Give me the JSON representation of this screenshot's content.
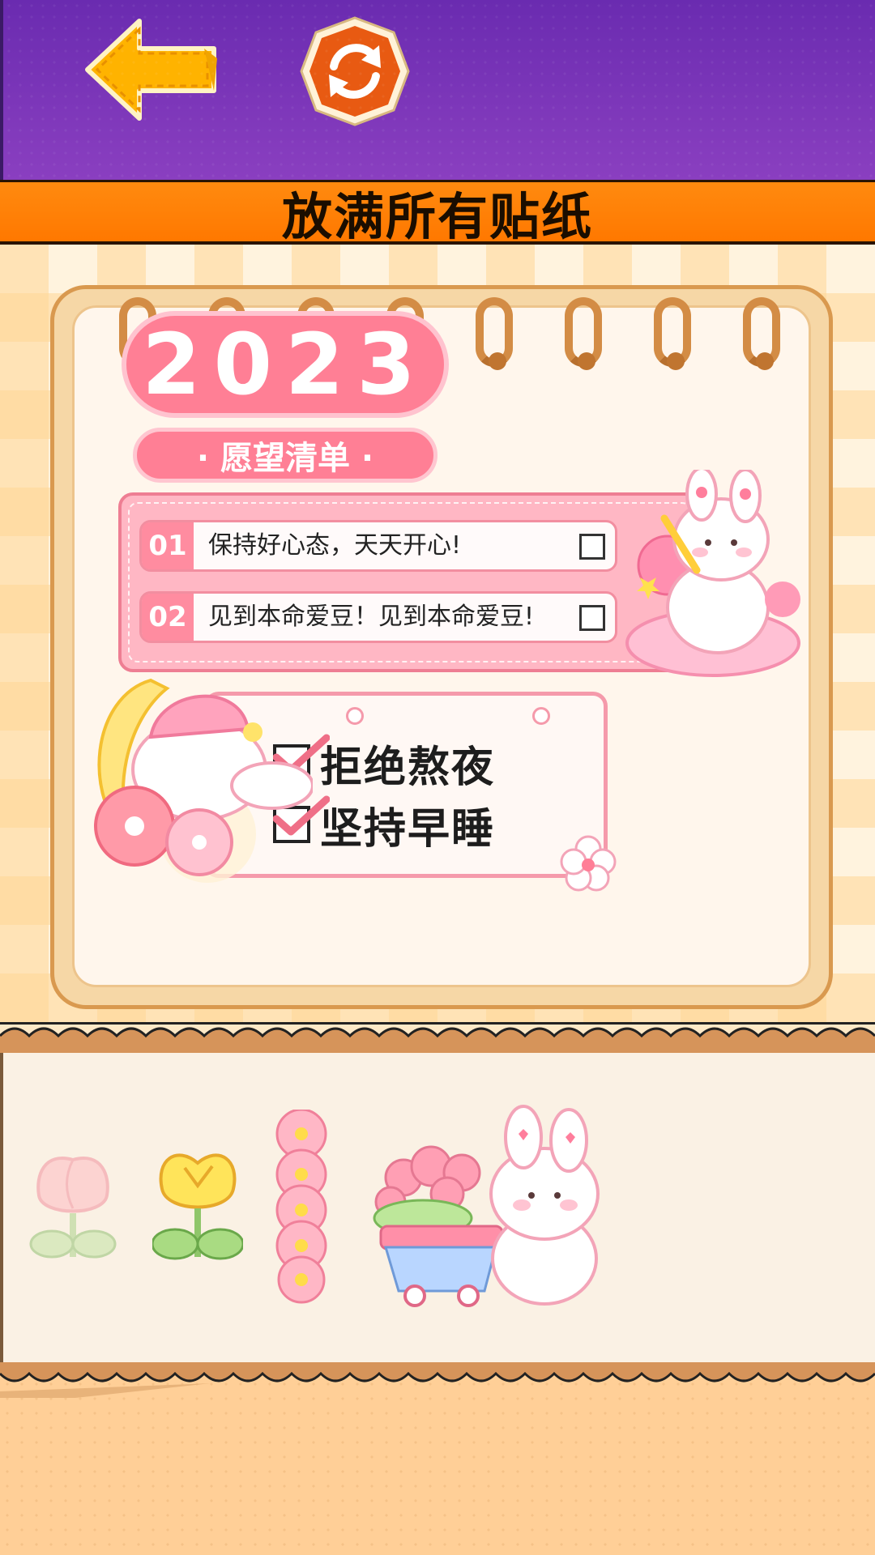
{
  "header": {
    "back_icon": "back-arrow-icon",
    "refresh_icon": "refresh-icon",
    "title": "放满所有贴纸"
  },
  "notebook": {
    "year": "2023",
    "wish_title": "· 愿望清单 ·",
    "wishes": [
      {
        "num": "01",
        "text": "保持好心态，天天开心!"
      },
      {
        "num": "02",
        "text": "见到本命爱豆！见到本命爱豆!"
      }
    ],
    "habits": [
      "拒绝熬夜",
      "坚持早睡"
    ]
  },
  "tray": {
    "stickers": [
      "pink-tulip-sticker",
      "yellow-tulip-sticker",
      "pink-flower-column-sticker",
      "bunny-flower-cart-sticker"
    ]
  },
  "colors": {
    "header_purple": "#7a35b8",
    "title_orange": "#ff7f0a",
    "accent_pink": "#ff7f95"
  }
}
